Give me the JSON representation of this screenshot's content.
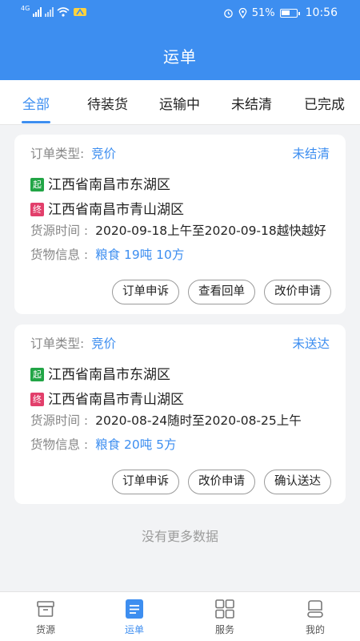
{
  "status_bar": {
    "network": "4G",
    "battery": "51%",
    "time": "10:56"
  },
  "header": {
    "title": "运单"
  },
  "tabs": [
    {
      "label": "全部",
      "active": true
    },
    {
      "label": "待装货"
    },
    {
      "label": "运输中"
    },
    {
      "label": "未结清"
    },
    {
      "label": "已完成"
    }
  ],
  "orders": [
    {
      "type_label": "订单类型:",
      "type_value": "竞价",
      "status": "未结清",
      "start_tag": "起",
      "start": "江西省南昌市东湖区",
      "end_tag": "终",
      "end": "江西省南昌市青山湖区",
      "time_label": "货源时间 :",
      "time_value": "2020-09-18上午至2020-09-18越快越好",
      "goods_label": "货物信息 :",
      "goods_value": "粮食 19吨 10方",
      "buttons": [
        "订单申诉",
        "查看回单",
        "改价申请"
      ]
    },
    {
      "type_label": "订单类型:",
      "type_value": "竞价",
      "status": "未送达",
      "start_tag": "起",
      "start": "江西省南昌市东湖区",
      "end_tag": "终",
      "end": "江西省南昌市青山湖区",
      "time_label": "货源时间 :",
      "time_value": "2020-08-24随时至2020-08-25上午",
      "goods_label": "货物信息 :",
      "goods_value": "粮食 20吨 5方",
      "buttons": [
        "订单申诉",
        "改价申请",
        "确认送达"
      ]
    }
  ],
  "no_more": "没有更多数据",
  "bottom_nav": [
    {
      "label": "货源",
      "icon": "box-icon"
    },
    {
      "label": "运单",
      "icon": "document-icon",
      "active": true
    },
    {
      "label": "服务",
      "icon": "grid-icon"
    },
    {
      "label": "我的",
      "icon": "user-icon"
    }
  ],
  "colors": {
    "brand": "#3d8ef0",
    "start_tag": "#22a546",
    "end_tag": "#e23f6b"
  }
}
